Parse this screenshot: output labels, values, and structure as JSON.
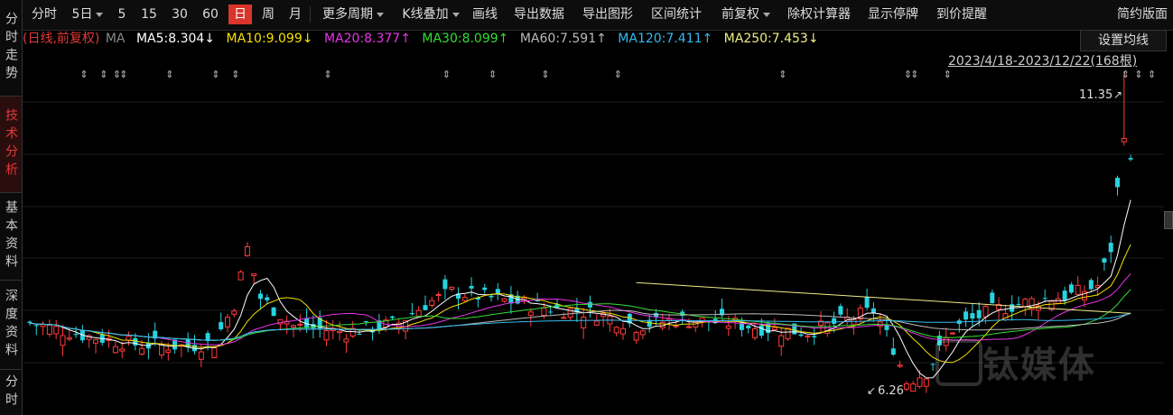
{
  "sidebar": {
    "tabs": [
      {
        "label": "分时走势",
        "active": false
      },
      {
        "label": "技术分析",
        "active": true
      },
      {
        "label": "基本资料",
        "active": false
      },
      {
        "label": "深度资料",
        "active": false
      },
      {
        "label": "分时",
        "active": false
      }
    ]
  },
  "toolbar": {
    "items": [
      {
        "label": "分时"
      },
      {
        "label": "5日",
        "dropdown": true
      },
      {
        "label": "5"
      },
      {
        "label": "15"
      },
      {
        "label": "30"
      },
      {
        "label": "60"
      },
      {
        "label": "日",
        "active": true
      },
      {
        "label": "周"
      },
      {
        "label": "月"
      },
      {
        "label": "更多周期",
        "dropdown": true
      },
      {
        "label": "K线叠加",
        "dropdown": true
      },
      {
        "label": "画线"
      },
      {
        "label": "导出数据"
      },
      {
        "label": "导出图形"
      },
      {
        "label": "区间统计"
      },
      {
        "label": "前复权",
        "dropdown": true
      },
      {
        "label": "除权计算器"
      },
      {
        "label": "显示停牌"
      },
      {
        "label": "到价提醒"
      }
    ],
    "right_label": "简约版面"
  },
  "ma_legend": {
    "prefix": "(日线,前复权)",
    "ma_label": "MA",
    "items": [
      {
        "text": "MA5:8.304↓",
        "color": "#ffffff"
      },
      {
        "text": "MA10:9.099↓",
        "color": "#f5e000"
      },
      {
        "text": "MA20:8.377↑",
        "color": "#e633e6"
      },
      {
        "text": "MA30:8.099↑",
        "color": "#33dd33"
      },
      {
        "text": "MA60:7.591↑",
        "color": "#bbbbbb"
      },
      {
        "text": "MA120:7.411↑",
        "color": "#33bbee"
      },
      {
        "text": "MA250:7.453↓",
        "color": "#eeee88"
      }
    ]
  },
  "settings_button": "设置均线",
  "date_range": "2023/4/18-2023/12/22(168根)",
  "annotations": {
    "high_label": "11.35",
    "low_label": "6.26"
  },
  "watermark": "钛媒体",
  "colors": {
    "up": "#ff3b3b",
    "down": "#27d3e0",
    "active_tab": "#d9362b"
  },
  "chart_data": {
    "type": "candlestick",
    "title": "",
    "xlabel": "",
    "ylabel": "",
    "candles_shown": 168,
    "ylim": [
      6.0,
      11.6
    ],
    "price_high": 11.35,
    "price_low": 6.26,
    "last_ma": {
      "MA5": 8.304,
      "MA10": 9.099,
      "MA20": 8.377,
      "MA30": 8.099,
      "MA60": 7.591,
      "MA120": 7.411,
      "MA250": 7.453
    }
  }
}
